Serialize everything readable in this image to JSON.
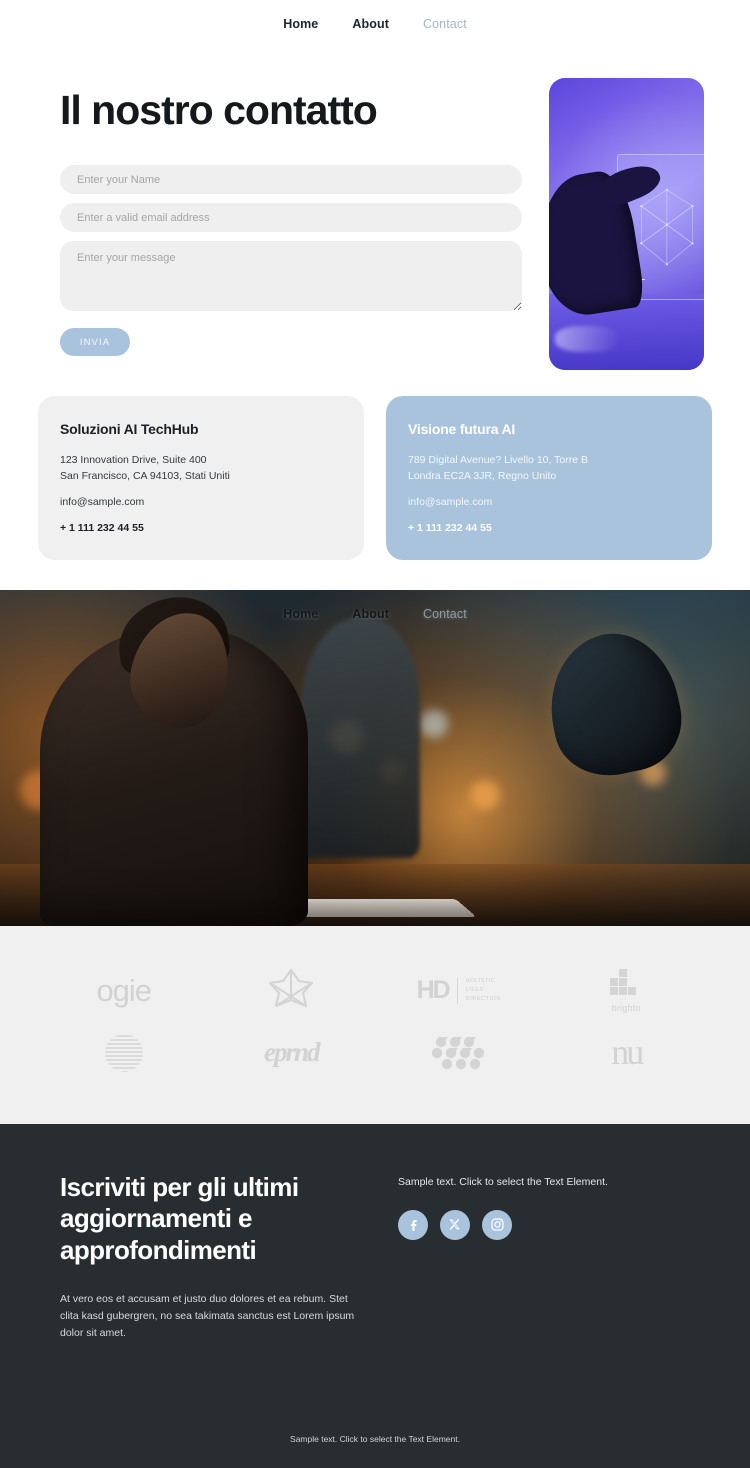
{
  "nav": {
    "items": [
      {
        "label": "Home",
        "muted": false
      },
      {
        "label": "About",
        "muted": false
      },
      {
        "label": "Contact",
        "muted": true
      }
    ]
  },
  "contact": {
    "title": "Il nostro contatto",
    "form": {
      "name_placeholder": "Enter your Name",
      "email_placeholder": "Enter a valid email address",
      "message_placeholder": "Enter your message",
      "submit_label": "INVIA"
    },
    "photo_alt": "hand-touching-holographic-screen"
  },
  "cards": [
    {
      "title": "Soluzioni AI TechHub",
      "address_line1": "123 Innovation Drive, Suite 400",
      "address_line2": "San Francisco, CA 94103, Stati Uniti",
      "email": "info@sample.com",
      "phone": "+ 1 111 232 44 55",
      "theme": "gray"
    },
    {
      "title": "Visione futura AI",
      "address_line1": "789 Digital Avenue? Livello 10, Torre B",
      "address_line2": "Londra EC2A 3JR, Regno Unito",
      "email": "info@sample.com",
      "phone": "+ 1 111 232 44 55",
      "theme": "blue"
    }
  ],
  "hero": {
    "alt": "woman-typing-with-humanoid-robot"
  },
  "logos": {
    "row1": [
      {
        "name": "ogie",
        "text": "ogie"
      },
      {
        "name": "flower-star-mark",
        "text": ""
      },
      {
        "name": "holistic-lifes-direction",
        "mark": "HD",
        "line1": "HOLISTIC",
        "line2": "LIFES",
        "line3": "DIRECTION"
      },
      {
        "name": "brighto",
        "text": "brighto"
      }
    ],
    "row2": [
      {
        "name": "striped-globe-mark",
        "text": ""
      },
      {
        "name": "eprnd-script",
        "text": "eprnd"
      },
      {
        "name": "dotted-teardrop-mark",
        "text": ""
      },
      {
        "name": "nu-serif-mark",
        "text": "nu"
      }
    ]
  },
  "footer": {
    "heading": "Iscriviti per gli ultimi aggiornamenti e approfondimenti",
    "body": "At vero eos et accusam et justo duo dolores et ea rebum. Stet clita kasd gubergren, no sea takimata sanctus est Lorem ipsum dolor sit amet.",
    "sample_text": "Sample text. Click to select the Text Element.",
    "socials": [
      {
        "name": "facebook",
        "glyph": "f"
      },
      {
        "name": "x-twitter",
        "glyph": "✕"
      },
      {
        "name": "instagram",
        "glyph": "▢"
      }
    ],
    "bottom_text": "Sample text. Click to select the Text Element."
  },
  "colors": {
    "accent_blue": "#a9c3dd",
    "field_gray": "#efefef",
    "card_gray": "#f0f0f0",
    "footer_dark": "#282d31",
    "text_dark": "#16191c",
    "muted": "#aab4bd"
  }
}
